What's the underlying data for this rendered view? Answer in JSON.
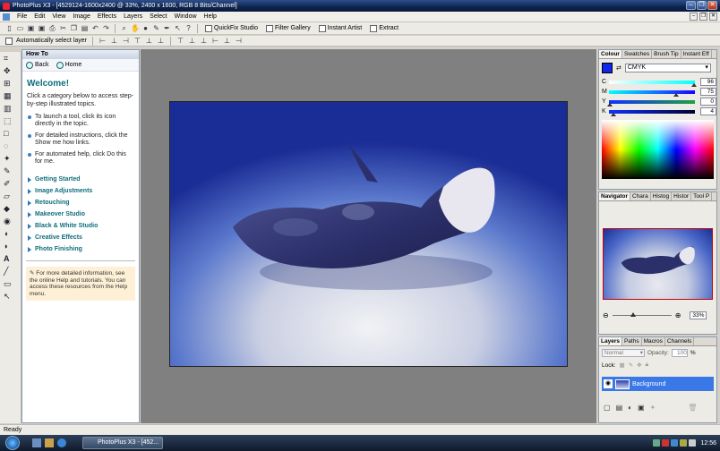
{
  "window": {
    "title": "PhotoPlus X3 - [4529124-1600x2400 @ 33%, 2400 x 1600, RGB 8 Bits/Channel]"
  },
  "menu": [
    "File",
    "Edit",
    "View",
    "Image",
    "Effects",
    "Layers",
    "Select",
    "Window",
    "Help"
  ],
  "toolbar": {
    "quickfix": "QuickFix Studio",
    "filter_gallery": "Filter Gallery",
    "instant_artist": "Instant Artist",
    "extract": "Extract"
  },
  "context_bar": {
    "auto_select": "Automatically select layer"
  },
  "howto": {
    "title": "How To",
    "back": "Back",
    "home": "Home",
    "welcome": "Welcome!",
    "intro": "Click a category below to access step-by-step illustrated topics.",
    "tips": [
      "To launch a tool, click its icon directly in the topic.",
      "For detailed instructions, click the Show me how links.",
      "For automated help, click Do this for me."
    ],
    "categories": [
      "Getting Started",
      "Image Adjustments",
      "Retouching",
      "Makeover Studio",
      "Black & White Studio",
      "Creative Effects",
      "Photo Finishing"
    ],
    "note": "For more detailed information, see the online Help and tutorials. You can access these resources from the Help menu."
  },
  "colour_panel": {
    "tabs": [
      "Colour",
      "Swatches",
      "Brush Tip",
      "Instant Eff"
    ],
    "mode": "CMYK",
    "channels": [
      {
        "label": "C",
        "value": "96"
      },
      {
        "label": "M",
        "value": "75"
      },
      {
        "label": "Y",
        "value": "0"
      },
      {
        "label": "K",
        "value": "4"
      }
    ],
    "fg_color": "#1228e8"
  },
  "navigator_panel": {
    "tabs": [
      "Navigator",
      "Chara",
      "Histog",
      "Histor",
      "Tool P"
    ],
    "zoom": "33%"
  },
  "layers_panel": {
    "tabs": [
      "Layers",
      "Paths",
      "Macros",
      "Channels"
    ],
    "blend_mode": "Normal",
    "opacity_label": "Opacity:",
    "opacity": "100",
    "opacity_unit": "%",
    "lock_label": "Lock:",
    "layer_name": "Background"
  },
  "status": {
    "text": "Ready"
  },
  "taskbar": {
    "task": "PhotoPlus X3 - [452...",
    "clock": "12:56"
  }
}
